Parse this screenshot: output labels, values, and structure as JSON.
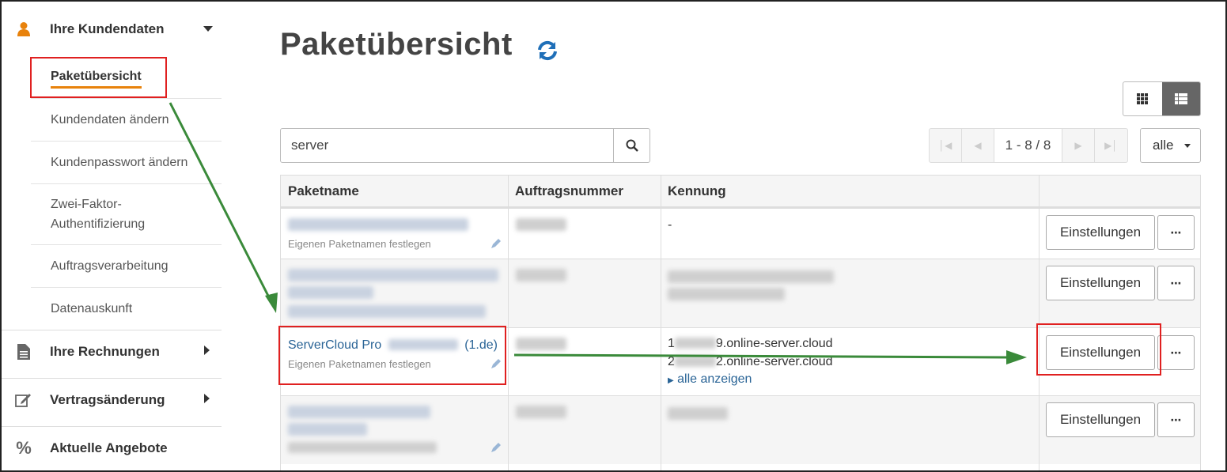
{
  "sidebar": {
    "customer": {
      "label": "Ihre Kundendaten",
      "icon": "user-icon",
      "color": "#e8820c"
    },
    "sub_items": [
      {
        "label": "Paketübersicht",
        "active": true
      },
      {
        "label": "Kundendaten ändern"
      },
      {
        "label": "Kundenpasswort ändern"
      },
      {
        "label": "Zwei-Faktor-\nAuthentifizierung"
      },
      {
        "label": "Auftragsverarbeitung"
      },
      {
        "label": "Datenauskunft"
      }
    ],
    "invoices": {
      "label": "Ihre Rechnungen",
      "icon": "document-icon"
    },
    "contract": {
      "label": "Vertragsänderung",
      "icon": "edit-icon"
    },
    "offers": {
      "label": "Aktuelle Angebote",
      "icon": "percent-icon"
    }
  },
  "main": {
    "title": "Paketübersicht",
    "search": {
      "value": "server"
    },
    "pagination": {
      "range": "1 - 8 / 8"
    },
    "per_page": "alle",
    "table": {
      "headers": [
        "Paketname",
        "Auftragsnummer",
        "Kennung",
        ""
      ],
      "rows": [
        {
          "name": "",
          "name_hint": "Eigenen Paketnamen festlegen",
          "kennung": "-",
          "settings": "Einstellungen"
        },
        {
          "name": "",
          "kennung": "",
          "settings": "Einstellungen"
        },
        {
          "name": "ServerCloud Pro",
          "name_suffix": "(1.de)",
          "name_hint": "Eigenen Paketnamen festlegen",
          "kennung_1_a": "1",
          "kennung_1_b": "9.online-server.cloud",
          "kennung_2_a": "2",
          "kennung_2_b": "2.online-server.cloud",
          "show_all": "alle anzeigen",
          "settings": "Einstellungen"
        },
        {
          "name": "",
          "kennung": "",
          "settings": "Einstellungen"
        }
      ]
    }
  },
  "colors": {
    "accent": "#e8820c",
    "link": "#2a6496",
    "annotation_box": "#e02020",
    "annotation_arrow": "#3a8a3a"
  }
}
